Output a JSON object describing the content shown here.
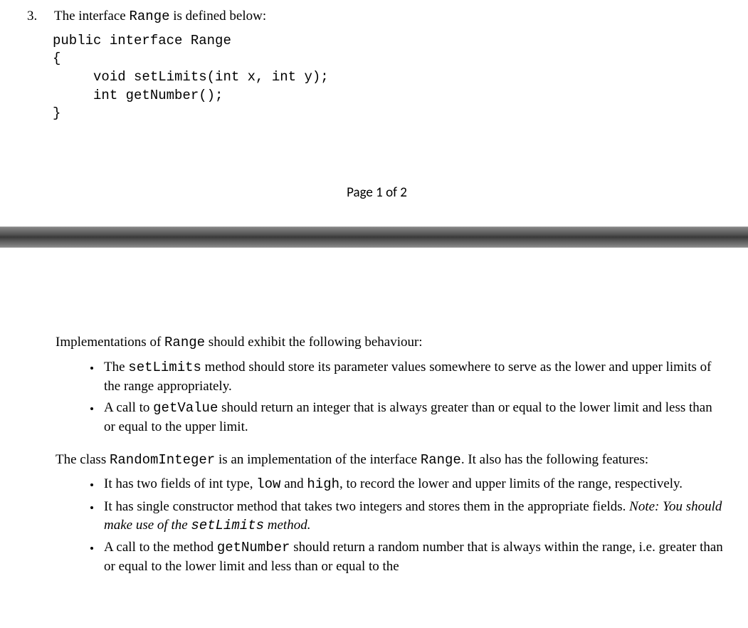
{
  "question": {
    "number": "3.",
    "intro_pre": "The interface ",
    "intro_code": "Range",
    "intro_post": " is defined below:"
  },
  "code": {
    "line1": "public interface Range",
    "line2": "{",
    "line3": "     void setLimits(int x, int y);",
    "line4": "     int getNumber();",
    "line5": "}"
  },
  "footer": {
    "page_label": "Page 1 of 2"
  },
  "page2": {
    "impl_intro_pre": "Implementations of ",
    "impl_intro_code": "Range",
    "impl_intro_post": " should exhibit the following behaviour:",
    "bullets1": {
      "b1_pre": "The ",
      "b1_code": "setLimits",
      "b1_post": " method should store its parameter values somewhere to serve as the lower and upper limits of the range appropriately.",
      "b2_pre": "A call to ",
      "b2_code": "getValue",
      "b2_post": " should return an integer that is always greater than or equal to the lower limit and less than or equal to the upper limit."
    },
    "class_intro_pre": "The class ",
    "class_intro_code1": "RandomInteger",
    "class_intro_mid": " is an implementation of the interface ",
    "class_intro_code2": "Range",
    "class_intro_post": ".  It also has the following features:",
    "bullets2": {
      "b1_pre": "It has two fields of int type, ",
      "b1_code1": "low",
      "b1_mid": " and ",
      "b1_code2": "high",
      "b1_post": ", to record the lower and upper limits of the range, respectively.",
      "b2_pre": "It has single constructor method that takes two integers and stores them in the appropriate fields. ",
      "b2_note_pre": "Note: You should make use of the ",
      "b2_note_code": "setLimits",
      "b2_note_post": " method.",
      "b3_pre": "A call to the method ",
      "b3_code": "getNumber",
      "b3_post": "  should return a random number that is always within the range, i.e. greater than or equal to the lower limit and less than or equal to the"
    }
  }
}
